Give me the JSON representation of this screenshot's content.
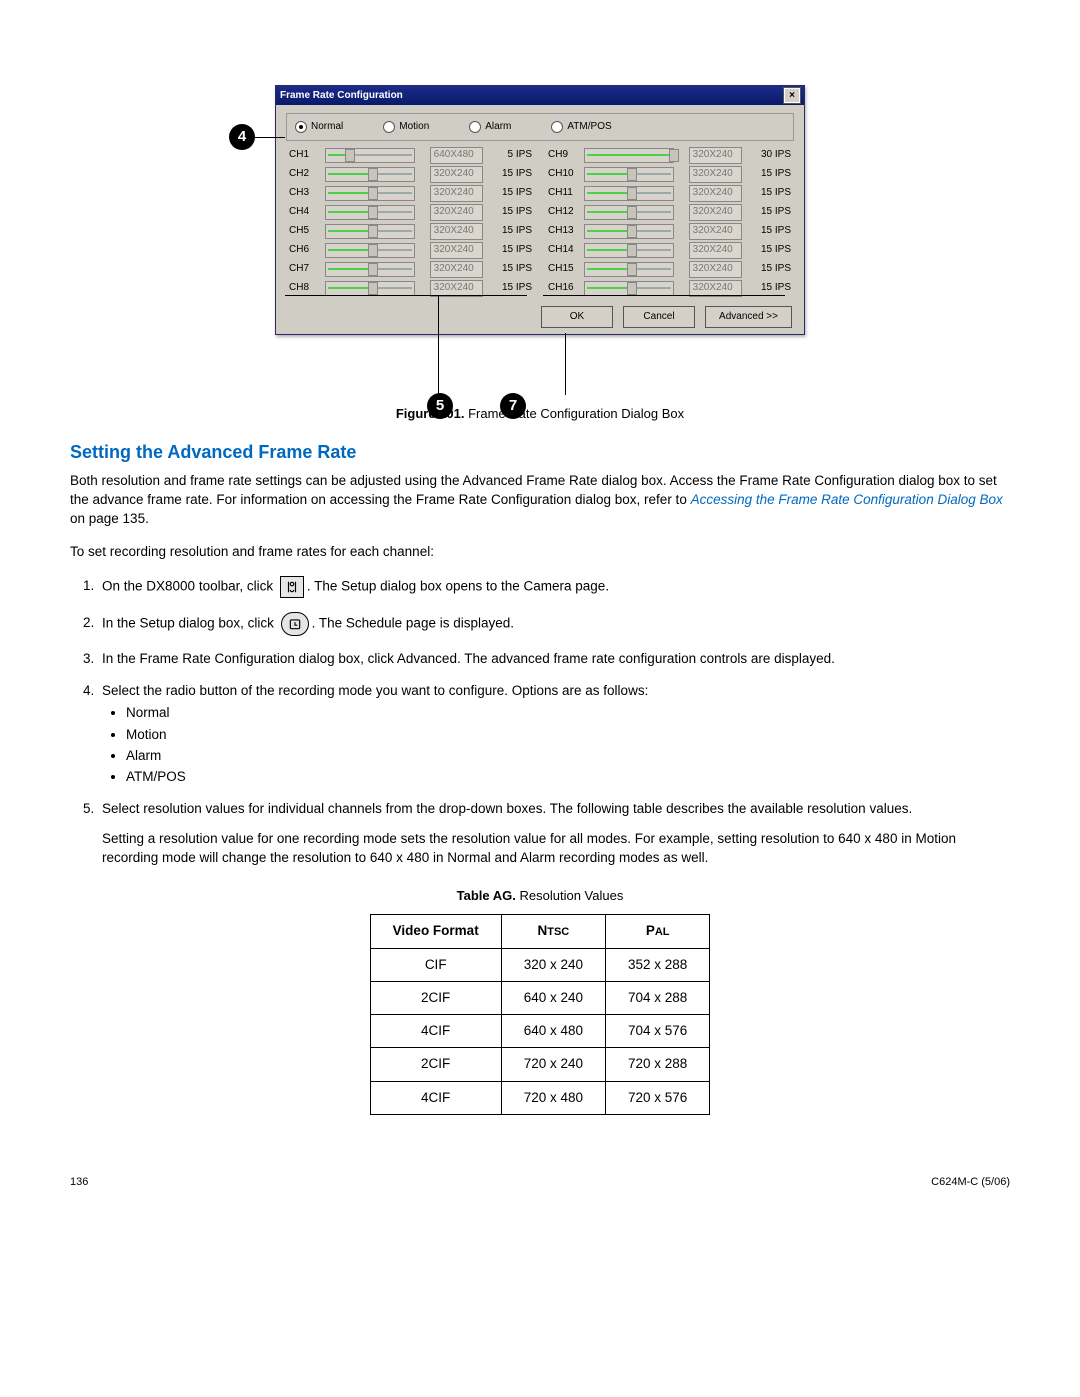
{
  "dialog": {
    "title": "Frame Rate Configuration",
    "modes": [
      "Normal",
      "Motion",
      "Alarm",
      "ATM/POS"
    ],
    "selectedModeIndex": 0,
    "channels_left": [
      {
        "name": "CH1",
        "res": "640X480",
        "ips": "5 IPS",
        "fill": 22
      },
      {
        "name": "CH2",
        "res": "320X240",
        "ips": "15 IPS",
        "fill": 48
      },
      {
        "name": "CH3",
        "res": "320X240",
        "ips": "15 IPS",
        "fill": 48
      },
      {
        "name": "CH4",
        "res": "320X240",
        "ips": "15 IPS",
        "fill": 48
      },
      {
        "name": "CH5",
        "res": "320X240",
        "ips": "15 IPS",
        "fill": 48
      },
      {
        "name": "CH6",
        "res": "320X240",
        "ips": "15 IPS",
        "fill": 48
      },
      {
        "name": "CH7",
        "res": "320X240",
        "ips": "15 IPS",
        "fill": 48
      },
      {
        "name": "CH8",
        "res": "320X240",
        "ips": "15 IPS",
        "fill": 48
      }
    ],
    "channels_right": [
      {
        "name": "CH9",
        "res": "320X240",
        "ips": "30 IPS",
        "fill": 95
      },
      {
        "name": "CH10",
        "res": "320X240",
        "ips": "15 IPS",
        "fill": 48
      },
      {
        "name": "CH11",
        "res": "320X240",
        "ips": "15 IPS",
        "fill": 48
      },
      {
        "name": "CH12",
        "res": "320X240",
        "ips": "15 IPS",
        "fill": 48
      },
      {
        "name": "CH13",
        "res": "320X240",
        "ips": "15 IPS",
        "fill": 48
      },
      {
        "name": "CH14",
        "res": "320X240",
        "ips": "15 IPS",
        "fill": 48
      },
      {
        "name": "CH15",
        "res": "320X240",
        "ips": "15 IPS",
        "fill": 48
      },
      {
        "name": "CH16",
        "res": "320X240",
        "ips": "15 IPS",
        "fill": 48
      }
    ],
    "buttons": {
      "ok": "OK",
      "cancel": "Cancel",
      "advanced": "Advanced >>"
    }
  },
  "callouts": {
    "c4": "4",
    "c5": "5",
    "c7": "7"
  },
  "figure_caption_label": "Figure 101.",
  "figure_caption_text": " Frame Rate Configuration Dialog Box",
  "section_heading": "Setting the Advanced Frame Rate",
  "para1_a": "Both resolution and frame rate settings can be adjusted using the Advanced Frame Rate dialog box. Access the Frame Rate Configuration dialog box to set the advance frame rate. For information on accessing the Frame Rate Configuration dialog box, refer to ",
  "para1_link": "Accessing the Frame Rate Configuration Dialog Box",
  "para1_b": " on page 135.",
  "para2": "To set recording resolution and frame rates for each channel:",
  "step1_a": "On the DX8000 toolbar, click ",
  "step1_b": ". The Setup dialog box opens to the Camera page.",
  "step2_a": "In the Setup dialog box, click ",
  "step2_b": ". The Schedule page is displayed.",
  "step3": "In the Frame Rate Configuration dialog box, click Advanced. The advanced frame rate configuration controls are displayed.",
  "step4_a": "Select the radio button of the recording mode you want to configure. Options are as follows:",
  "step4_opts": [
    "Normal",
    "Motion",
    "Alarm",
    "ATM/POS"
  ],
  "step5_a": "Select resolution values for individual channels from the drop-down boxes. The following table describes the available resolution values.",
  "step5_b": "Setting a resolution value for one recording mode sets the resolution value for all modes. For example, setting resolution to 640 x 480 in Motion recording mode will change the resolution to 640 x 480 in Normal and Alarm recording modes as well.",
  "table_caption_label": "Table AG.",
  "table_caption_text": " Resolution Values",
  "table": {
    "headers": [
      "Video Format",
      "NTSC",
      "PAL"
    ],
    "rows": [
      [
        "CIF",
        "320 x 240",
        "352 x 288"
      ],
      [
        "2CIF",
        "640 x 240",
        "704 x 288"
      ],
      [
        "4CIF",
        "640 x 480",
        "704 x 576"
      ],
      [
        "2CIF",
        "720 x 240",
        "720 x 288"
      ],
      [
        "4CIF",
        "720 x 480",
        "720 x 576"
      ]
    ]
  },
  "footer": {
    "page": "136",
    "doc": "C624M-C (5/06)"
  }
}
